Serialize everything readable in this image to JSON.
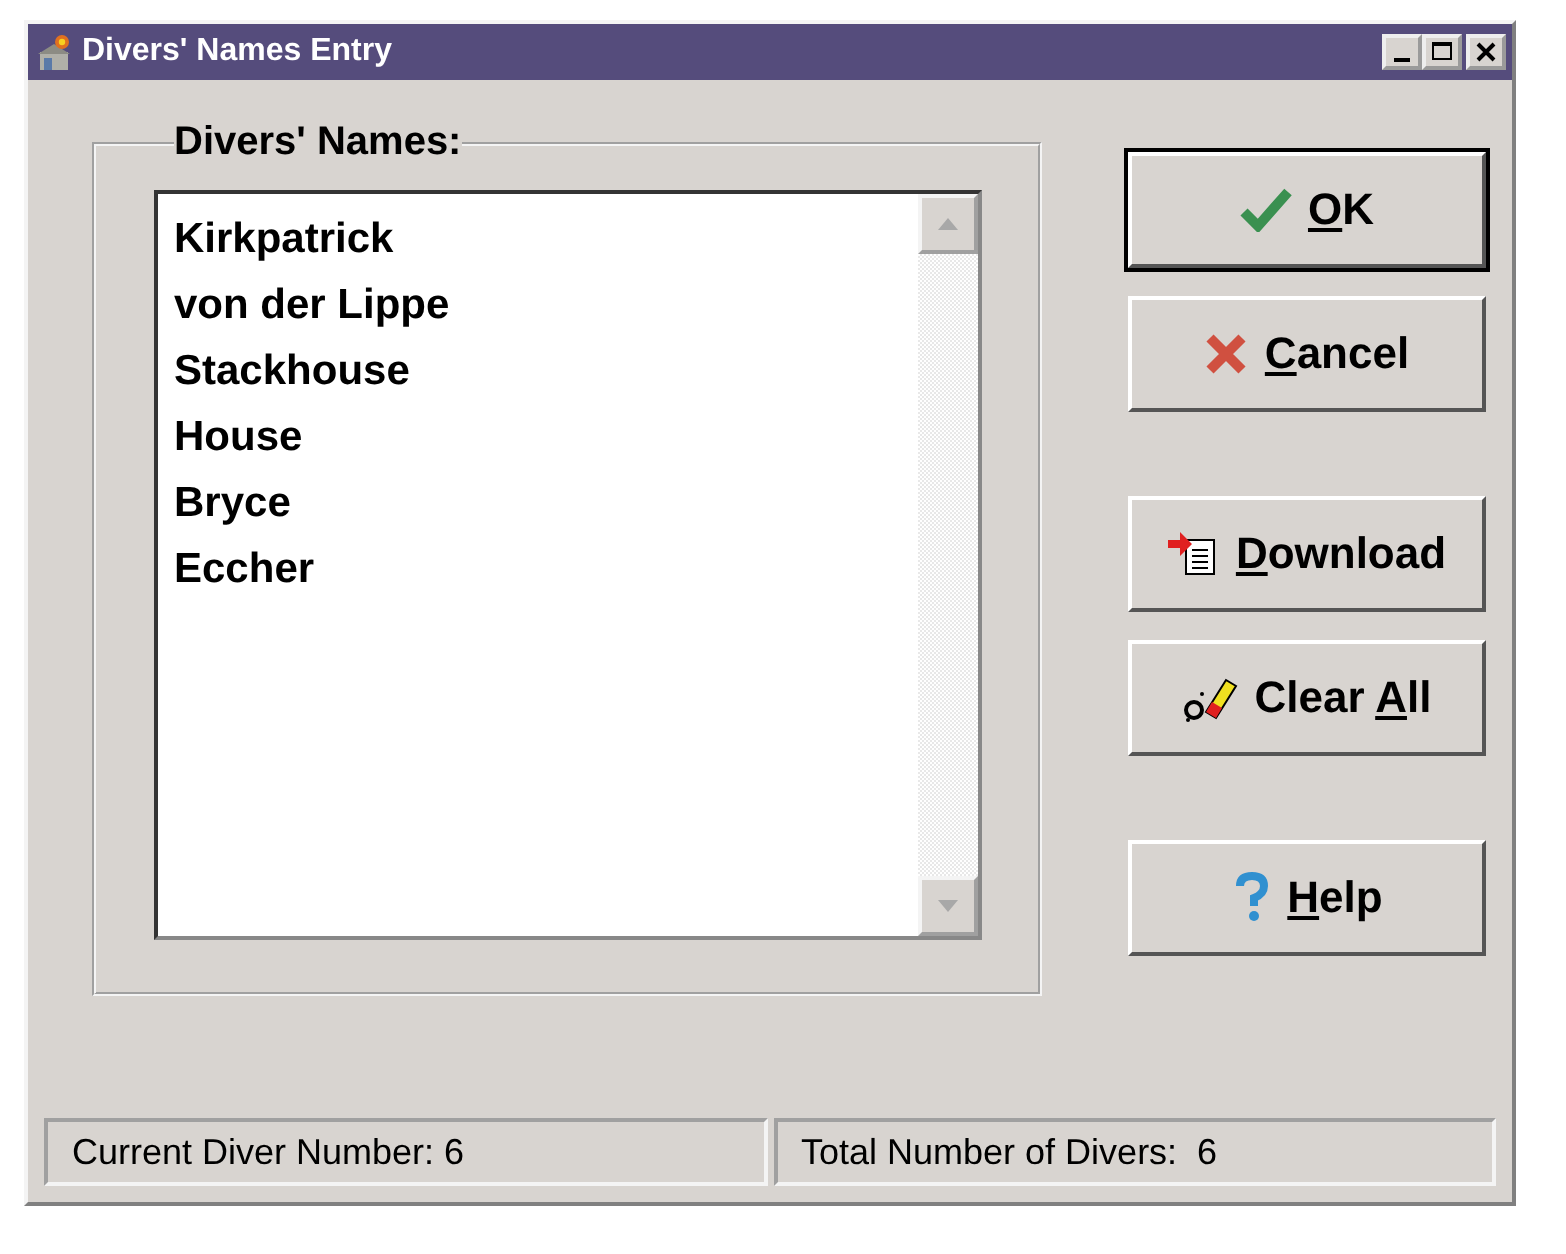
{
  "window": {
    "title": "Divers' Names Entry"
  },
  "group": {
    "title": "Divers' Names:"
  },
  "names": [
    "Kirkpatrick",
    "von der Lippe",
    "Stackhouse",
    "House",
    "Bryce",
    "Eccher"
  ],
  "scrollbar": {
    "disabled": true
  },
  "buttons": [
    {
      "kind": "ok",
      "key": "O",
      "after": "K",
      "default": true
    },
    {
      "kind": "cancel",
      "key": "C",
      "after": "ancel",
      "default": false
    },
    {
      "kind": "download",
      "key": "D",
      "after": "ownload",
      "default": false
    },
    {
      "kind": "clear",
      "before": "Clear ",
      "key": "A",
      "after": "ll",
      "default": false
    },
    {
      "kind": "help",
      "key": "H",
      "after": "elp",
      "default": false
    }
  ],
  "status_bar": [
    "Current Diver Number: 6",
    "Total Number of Divers:  6"
  ]
}
